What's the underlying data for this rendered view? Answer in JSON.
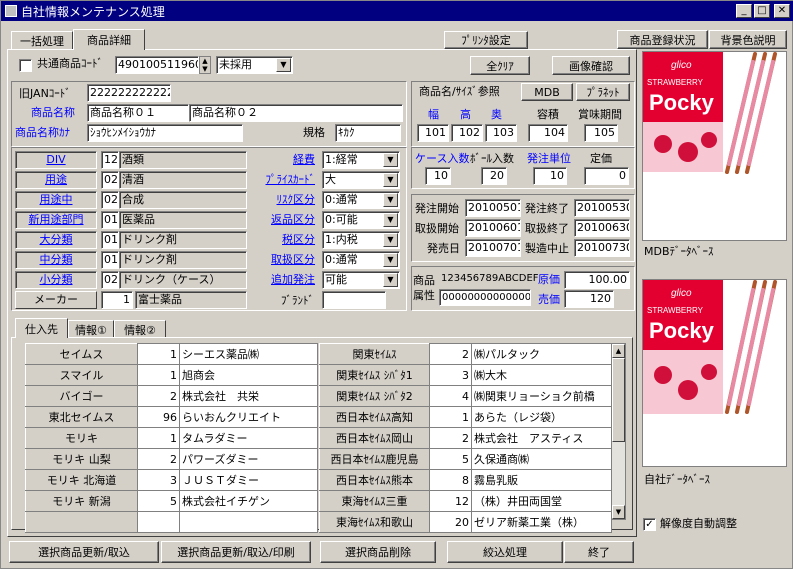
{
  "window": {
    "title": "自社情報メンテナンス処理"
  },
  "tabs": {
    "bulk": "一括処理",
    "detail": "商品詳細"
  },
  "top_buttons": {
    "print_settings": "ﾌﾟﾘﾝﾀ設定",
    "reg_status": "商品登録状況",
    "bg_desc": "背景色説明",
    "clear_all": "全ｸﾘｱ",
    "image_confirm": "画像確認"
  },
  "common_code": {
    "label": "共通商品ｺｰﾄﾞ",
    "value": "4901005119604",
    "status": "未採用",
    "checked": false
  },
  "old_jan": {
    "label": "旧JANｺｰﾄﾞ",
    "value": "2222222222222"
  },
  "product_name": {
    "label": "商品名称",
    "value1": "商品名称０１",
    "value2": "商品名称０２"
  },
  "product_kana": {
    "label": "商品名称ｶﾅ",
    "value": "ｼｮｳﾋﾝﾒｲｼｮｳｶﾅ"
  },
  "spec": {
    "label": "規格",
    "value": "ｷｶｸ"
  },
  "size_ref": {
    "label": "商品名/ｻｲｽﾞ参照",
    "mdb": "MDB",
    "planet": "ﾌﾟﾗﾈｯﾄ"
  },
  "dims": {
    "width_label": "幅",
    "height_label": "高",
    "depth_label": "奥",
    "capacity_label": "容積",
    "shelf_life_label": "賞味期間",
    "width": "101",
    "height": "102",
    "depth": "103",
    "capacity": "104",
    "shelf_life": "105"
  },
  "qty": {
    "case_label": "ケース入数",
    "ball_label": "ﾎﾞｰﾙ入数",
    "order_unit_label": "発注単位",
    "list_price_label": "定価",
    "case": "10",
    "ball": "20",
    "order_unit": "10",
    "list_price": "0"
  },
  "classes": [
    {
      "label": "DIV",
      "code": "12",
      "name": "酒類"
    },
    {
      "label": "用途",
      "code": "02",
      "name": "清酒"
    },
    {
      "label": "用途中",
      "code": "02",
      "name": "合成"
    },
    {
      "label": "新用途部門",
      "code": "01",
      "name": "医薬品"
    },
    {
      "label": "大分類",
      "code": "01",
      "name": "ドリンク剤"
    },
    {
      "label": "中分類",
      "code": "01",
      "name": "ドリンク剤"
    },
    {
      "label": "小分類",
      "code": "02",
      "name": "ドリンク（ケース）"
    }
  ],
  "maker": {
    "label": "メーカー",
    "code": "1",
    "name": "富士薬品"
  },
  "selects": [
    {
      "label": "経費",
      "value": "1:経常"
    },
    {
      "label": "ﾌﾟﾗｲｽｶｰﾄﾞ",
      "value": "大"
    },
    {
      "label": "ﾘｽｸ区分",
      "value": "0:通常"
    },
    {
      "label": "返品区分",
      "value": "0:可能"
    },
    {
      "label": "税区分",
      "value": "1:内税"
    },
    {
      "label": "取扱区分",
      "value": "0:通常"
    },
    {
      "label": "追加発注",
      "value": "可能"
    }
  ],
  "brand": {
    "label": "ﾌﾞﾗﾝﾄﾞ",
    "value": ""
  },
  "dates": {
    "order_start_label": "発注開始",
    "order_start": "20100501",
    "order_end_label": "発注終了",
    "order_end": "20100530",
    "handle_start_label": "取扱開始",
    "handle_start": "20100601",
    "handle_end_label": "取扱終了",
    "handle_end": "20100630",
    "release_label": "発売日",
    "release": "20100701",
    "discontinue_label": "製造中止",
    "discontinue": "20100730"
  },
  "attr": {
    "label1": "商品",
    "label2": "属性",
    "code": "123456789ABCDEF",
    "value": "000000000000000",
    "cost_label": "原価",
    "cost": "100.00",
    "price_label": "売価",
    "price": "120"
  },
  "images": {
    "mdb_label": "MDBﾃﾞｰﾀﾍﾞｰｽ",
    "own_label": "自社ﾃﾞｰﾀﾍﾞｰｽ",
    "brand_text": "glico",
    "product_top": "STRAWBERRY",
    "product_name": "Pocky",
    "auto_resize": "解像度自動調整",
    "auto_resize_checked": true
  },
  "lower_tabs": {
    "suppliers": "仕入先",
    "info1": "情報①",
    "info2": "情報②"
  },
  "suppliers_left": [
    {
      "name": "セイムス",
      "num": "1",
      "vendor": "シーエス薬品㈱"
    },
    {
      "name": "スマイル",
      "num": "1",
      "vendor": "旭商会"
    },
    {
      "name": "バイゴー",
      "num": "2",
      "vendor": "株式会社　共栄"
    },
    {
      "name": "東北セイムス",
      "num": "96",
      "vendor": "らいおんクリエイト"
    },
    {
      "name": "モリキ",
      "num": "1",
      "vendor": "タムラダミー"
    },
    {
      "name": "モリキ 山梨",
      "num": "2",
      "vendor": "パワーズダミー"
    },
    {
      "name": "モリキ 北海道",
      "num": "3",
      "vendor": "ＪＵＳＴダミー"
    },
    {
      "name": "モリキ 新潟",
      "num": "5",
      "vendor": "株式会社イチゲン"
    },
    {
      "name": "",
      "num": "",
      "vendor": ""
    }
  ],
  "suppliers_right": [
    {
      "name": "関東ｾｲﾑｽ",
      "num": "2",
      "vendor": "㈱パルタック"
    },
    {
      "name": "関東ｾｲﾑｽ ｼﾊﾞﾀ1",
      "num": "3",
      "vendor": "㈱大木"
    },
    {
      "name": "関東ｾｲﾑｽ ｼﾊﾞﾀ2",
      "num": "4",
      "vendor": "㈱関東リョーショク前橋"
    },
    {
      "name": "西日本ｾｲﾑｽ高知",
      "num": "1",
      "vendor": "あらた（レジ袋）"
    },
    {
      "name": "西日本ｾｲﾑｽ岡山",
      "num": "2",
      "vendor": "株式会社　アスティス"
    },
    {
      "name": "西日本ｾｲﾑｽ鹿児島",
      "num": "5",
      "vendor": "久保通商㈱"
    },
    {
      "name": "西日本ｾｲﾑｽ熊本",
      "num": "8",
      "vendor": "霧島乳販"
    },
    {
      "name": "東海ｾｲﾑｽ三重",
      "num": "12",
      "vendor": "（株）井田両国堂"
    },
    {
      "name": "東海ｾｲﾑｽ和歌山",
      "num": "20",
      "vendor": "ゼリア新薬工業（株）"
    }
  ],
  "bottom_buttons": {
    "update": "選択商品更新/取込",
    "update_print": "選択商品更新/取込/印刷",
    "delete": "選択商品削除",
    "filter": "絞込処理",
    "exit": "終了"
  }
}
